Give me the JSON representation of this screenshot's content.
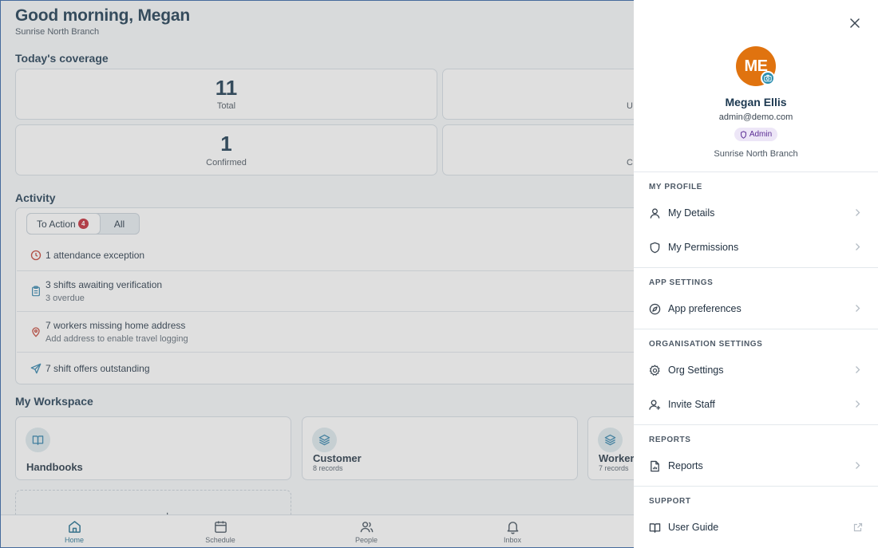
{
  "home": {
    "greeting": "Good morning, Megan",
    "branch": "Sunrise North Branch",
    "coverage": {
      "title": "Today's coverage",
      "stats": [
        {
          "value": "11",
          "label": "Total"
        },
        {
          "value": "",
          "label": "U"
        },
        {
          "value": "1",
          "label": "Confirmed"
        },
        {
          "value": "",
          "label": "C"
        }
      ]
    },
    "activity": {
      "title": "Activity",
      "tabs": {
        "to_action": "To Action",
        "to_action_count": "4",
        "all": "All"
      },
      "items": [
        {
          "title": "1 attendance exception",
          "subtitle": "",
          "icon": "clock-icon",
          "color": "#c0392b"
        },
        {
          "title": "3 shifts awaiting verification",
          "subtitle": "3 overdue",
          "icon": "clipboard-icon",
          "color": "#2a7ea8"
        },
        {
          "title": "7 workers missing home address",
          "subtitle": "Add address to enable travel logging",
          "icon": "map-pin-icon",
          "color": "#c0392b"
        },
        {
          "title": "7 shift offers outstanding",
          "subtitle": "",
          "icon": "send-icon",
          "color": "#2a7ea8"
        }
      ]
    },
    "workspace": {
      "title": "My Workspace",
      "cards": [
        {
          "title": "Handbooks",
          "subtitle": "",
          "icon": "book-icon"
        },
        {
          "title": "Customer",
          "subtitle": "8 records",
          "icon": "layers-icon"
        },
        {
          "title": "Worker",
          "subtitle": "7 records",
          "icon": "layers-icon"
        }
      ],
      "add_symbol": "+"
    }
  },
  "bottom_nav": [
    {
      "label": "Home",
      "icon": "home-icon",
      "active": true
    },
    {
      "label": "Schedule",
      "icon": "calendar-icon",
      "active": false
    },
    {
      "label": "People",
      "icon": "people-icon",
      "active": false
    },
    {
      "label": "Inbox",
      "icon": "bell-icon",
      "active": false
    }
  ],
  "profile": {
    "initials": "ME",
    "name": "Megan Ellis",
    "email": "admin@demo.com",
    "role": "Admin",
    "branch": "Sunrise North Branch",
    "avatar_color": "#e0730f"
  },
  "menu": {
    "my_profile": {
      "title": "MY PROFILE",
      "items": [
        {
          "label": "My Details",
          "icon": "user-icon"
        },
        {
          "label": "My Permissions",
          "icon": "shield-icon"
        }
      ]
    },
    "app_settings": {
      "title": "APP SETTINGS",
      "items": [
        {
          "label": "App preferences",
          "icon": "compass-icon"
        }
      ]
    },
    "org_settings": {
      "title": "ORGANISATION SETTINGS",
      "items": [
        {
          "label": "Org Settings",
          "icon": "gear-icon"
        },
        {
          "label": "Invite Staff",
          "icon": "user-plus-icon"
        }
      ]
    },
    "reports": {
      "title": "REPORTS",
      "items": [
        {
          "label": "Reports",
          "icon": "report-icon"
        }
      ]
    },
    "support": {
      "title": "SUPPORT",
      "items": [
        {
          "label": "User Guide",
          "icon": "book-icon"
        }
      ]
    }
  }
}
